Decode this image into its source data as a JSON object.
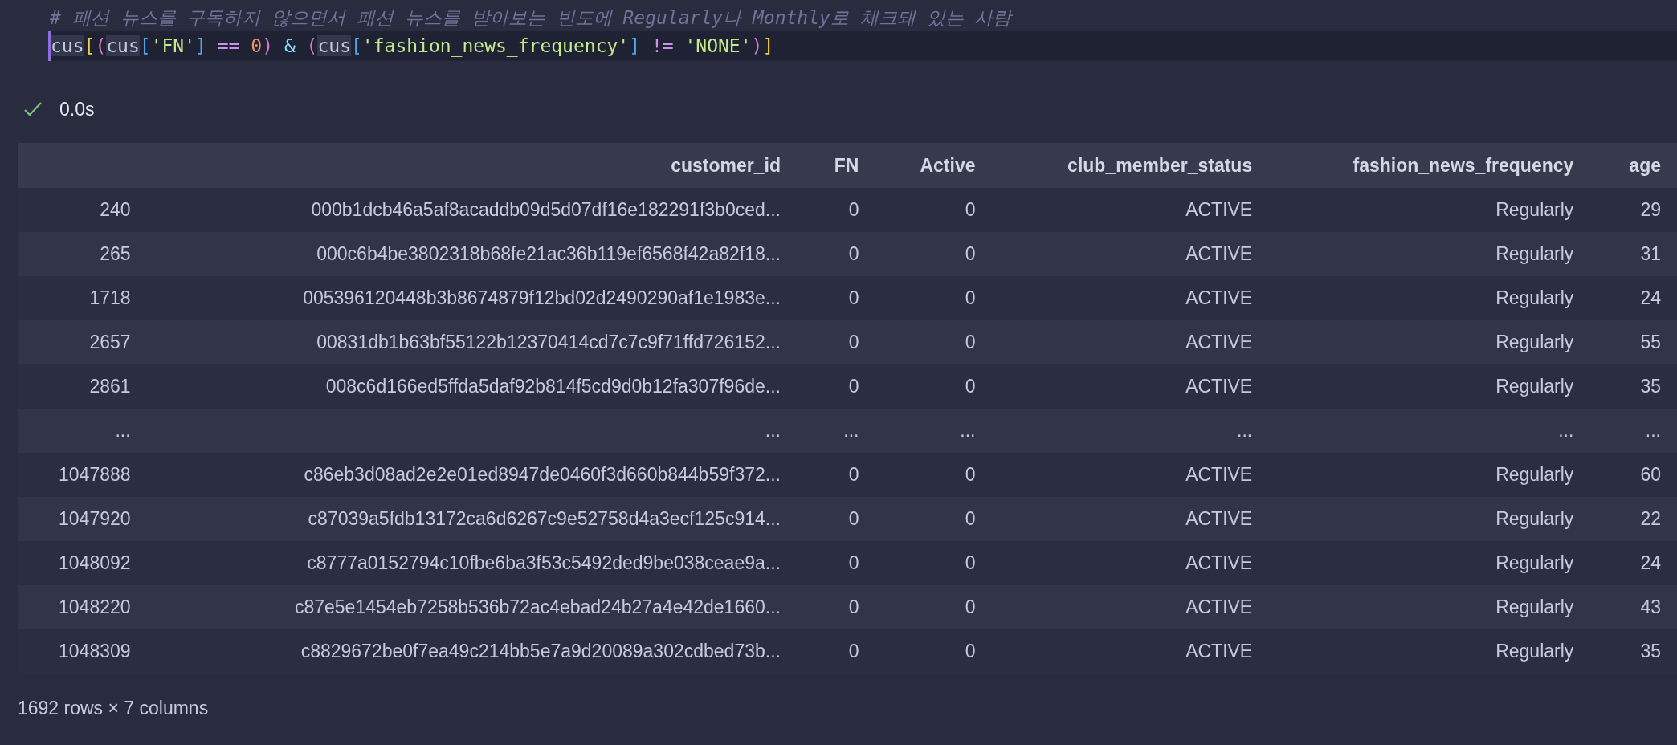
{
  "cell": {
    "comment": "# 패션 뉴스를 구독하지 않으면서 패션 뉴스를 받아보는 빈도에 Regularly나 Monthly로 체크돼 있는 사람",
    "code_tokens": [
      {
        "kind": "var",
        "text": "cus"
      },
      {
        "kind": "bracket_outer",
        "text": "["
      },
      {
        "kind": "paren",
        "text": "("
      },
      {
        "kind": "var",
        "text": "cus"
      },
      {
        "kind": "bracket_inner",
        "text": "["
      },
      {
        "kind": "string",
        "text": "'FN'"
      },
      {
        "kind": "bracket_inner",
        "text": "]"
      },
      {
        "kind": "compare",
        "text": " == "
      },
      {
        "kind": "number",
        "text": "0"
      },
      {
        "kind": "paren",
        "text": ")"
      },
      {
        "kind": "logical",
        "text": " & "
      },
      {
        "kind": "paren",
        "text": "("
      },
      {
        "kind": "var",
        "text": "cus"
      },
      {
        "kind": "bracket_inner",
        "text": "["
      },
      {
        "kind": "string",
        "text": "'fashion_news_frequency'"
      },
      {
        "kind": "bracket_inner",
        "text": "]"
      },
      {
        "kind": "compare",
        "text": " != "
      },
      {
        "kind": "string",
        "text": "'NONE'"
      },
      {
        "kind": "paren",
        "text": ")"
      },
      {
        "kind": "bracket_outer",
        "text": "]"
      }
    ],
    "succeeded": true,
    "duration": "0.0s"
  },
  "table": {
    "columns": [
      "customer_id",
      "FN",
      "Active",
      "club_member_status",
      "fashion_news_frequency",
      "age"
    ],
    "rows": [
      {
        "index": "240",
        "cells": [
          "000b1dcb46a5af8acaddb09d5d07df16e182291f3b0ced...",
          "0",
          "0",
          "ACTIVE",
          "Regularly",
          "29"
        ]
      },
      {
        "index": "265",
        "cells": [
          "000c6b4be3802318b68fe21ac36b119ef6568f42a82f18...",
          "0",
          "0",
          "ACTIVE",
          "Regularly",
          "31"
        ]
      },
      {
        "index": "1718",
        "cells": [
          "005396120448b3b8674879f12bd02d2490290af1e1983e...",
          "0",
          "0",
          "ACTIVE",
          "Regularly",
          "24"
        ]
      },
      {
        "index": "2657",
        "cells": [
          "00831db1b63bf55122b12370414cd7c7c9f71ffd726152...",
          "0",
          "0",
          "ACTIVE",
          "Regularly",
          "55"
        ]
      },
      {
        "index": "2861",
        "cells": [
          "008c6d166ed5ffda5daf92b814f5cd9d0b12fa307f96de...",
          "0",
          "0",
          "ACTIVE",
          "Regularly",
          "35"
        ]
      },
      {
        "index": "...",
        "cells": [
          "...",
          "...",
          "...",
          "...",
          "...",
          "..."
        ]
      },
      {
        "index": "1047888",
        "cells": [
          "c86eb3d08ad2e2e01ed8947de0460f3d660b844b59f372...",
          "0",
          "0",
          "ACTIVE",
          "Regularly",
          "60"
        ]
      },
      {
        "index": "1047920",
        "cells": [
          "c87039a5fdb13172ca6d6267c9e52758d4a3ecf125c914...",
          "0",
          "0",
          "ACTIVE",
          "Regularly",
          "22"
        ]
      },
      {
        "index": "1048092",
        "cells": [
          "c8777a0152794c10fbe6ba3f53c5492ded9be038ceae9a...",
          "0",
          "0",
          "ACTIVE",
          "Regularly",
          "24"
        ]
      },
      {
        "index": "1048220",
        "cells": [
          "c87e5e1454eb7258b536b72ac4ebad24b27a4e42de1660...",
          "0",
          "0",
          "ACTIVE",
          "Regularly",
          "43"
        ]
      },
      {
        "index": "1048309",
        "cells": [
          "c8829672be0f7ea49c214bb5e7a9d20089a302cdbed73b...",
          "0",
          "0",
          "ACTIVE",
          "Regularly",
          "35"
        ]
      }
    ],
    "summary": "1692 rows × 7 columns"
  }
}
